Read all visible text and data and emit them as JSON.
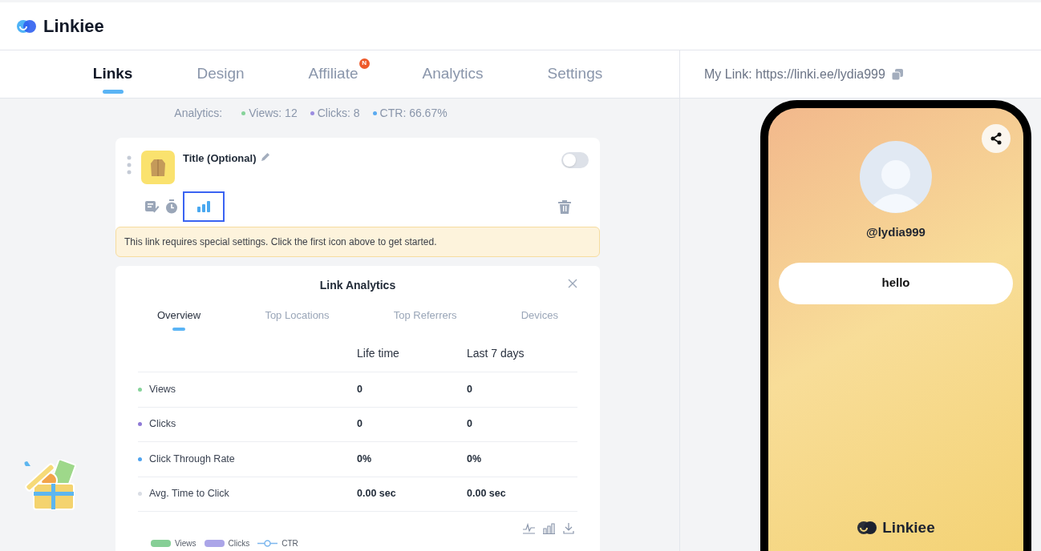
{
  "header": {
    "brand": "Linkiee"
  },
  "tabs": [
    {
      "label": "Links",
      "selected": true
    },
    {
      "label": "Design",
      "selected": false
    },
    {
      "label": "Affiliate",
      "selected": false,
      "badge": "N"
    },
    {
      "label": "Analytics",
      "selected": false
    },
    {
      "label": "Settings",
      "selected": false
    }
  ],
  "my_link": {
    "text": "My Link: https://linki.ee/lydia999"
  },
  "summary": {
    "label": "Analytics:",
    "stats": [
      {
        "text": "Views: 12",
        "color": "#86d39a"
      },
      {
        "text": "Clicks: 8",
        "color": "#9b8ce0"
      },
      {
        "text": "CTR: 66.67%",
        "color": "#5aaaf0"
      }
    ]
  },
  "link_card": {
    "title": "Title (Optional)",
    "enabled": false,
    "tools": [
      {
        "kind": "edit",
        "selected": false
      },
      {
        "kind": "timer",
        "selected": false
      },
      {
        "kind": "analytics",
        "selected": true
      }
    ],
    "notice": "This link requires special settings. Click the first icon above to get started."
  },
  "analytics_panel": {
    "title": "Link Analytics",
    "tabs": [
      {
        "label": "Overview",
        "selected": true
      },
      {
        "label": "Top Locations",
        "selected": false
      },
      {
        "label": "Top Referrers",
        "selected": false
      },
      {
        "label": "Devices",
        "selected": false
      }
    ],
    "columns": [
      "Life time",
      "Last 7 days"
    ],
    "rows": [
      {
        "label": "Views",
        "color": "#86d39a",
        "lifetime": "0",
        "last_7_days": "0"
      },
      {
        "label": "Clicks",
        "color": "#8f7ad6",
        "lifetime": "0",
        "last_7_days": "0"
      },
      {
        "label": "Click Through Rate",
        "color": "#4ea3ef",
        "lifetime": "0%",
        "last_7_days": "0%"
      },
      {
        "label": "Avg. Time to Click",
        "color": "#d9dde4",
        "lifetime": "0.00 sec",
        "last_7_days": "0.00 sec"
      }
    ],
    "legend": [
      {
        "label": "Views",
        "kind": "bar",
        "color": "#86cf96"
      },
      {
        "label": "Clicks",
        "kind": "bar",
        "color": "#aba5e8"
      },
      {
        "label": "CTR",
        "kind": "line",
        "color": "#7cb7ee"
      }
    ]
  },
  "phone": {
    "username": "@lydia999",
    "links": [
      "hello"
    ],
    "brand": "Linkiee"
  }
}
